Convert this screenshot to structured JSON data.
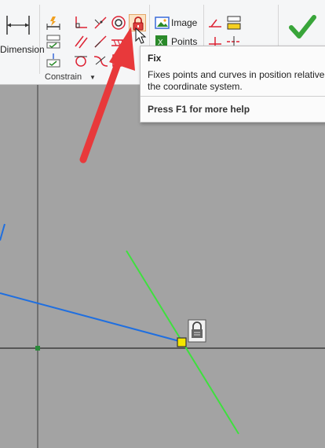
{
  "ribbon": {
    "dimension_label": "Dimension",
    "constrain_label": "Constrain",
    "image_label": "Image",
    "points_label": "Points",
    "icons": [
      "dimension-icon",
      "coincident-icon",
      "collinear-icon",
      "concentric-icon",
      "fix-icon",
      "parallel-icon",
      "perpendicular-icon",
      "horizontal-icon",
      "vertical-icon",
      "tangent-icon",
      "smooth-icon",
      "symmetric-icon",
      "equal-icon",
      "image-icon",
      "points-icon",
      "finish-sketch-icon"
    ]
  },
  "tooltip": {
    "title": "Fix",
    "description": "Fixes points and curves in position relative to the coordinate system.",
    "help": "Press F1 for more help"
  },
  "colors": {
    "canvas": "#a3a3a3",
    "axis": "#3c3c3c",
    "blue_line": "#1f6fe0",
    "green_line": "#3ee03e",
    "fixed_point": "#f5e600",
    "arrow": "#e8393b"
  }
}
